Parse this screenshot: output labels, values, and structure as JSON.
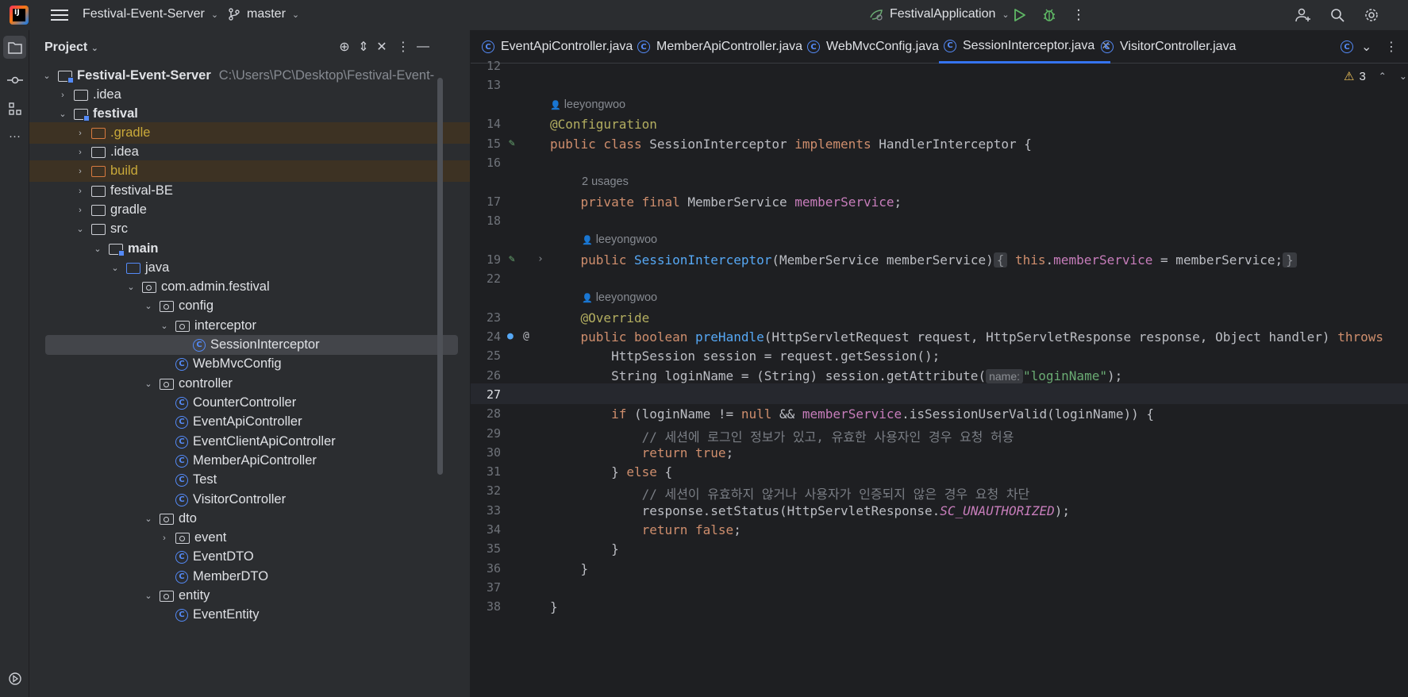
{
  "topbar": {
    "logo_text": "IJ",
    "project_name": "Festival-Event-Server",
    "branch": "master",
    "run_config": "FestivalApplication"
  },
  "project_panel": {
    "title": "Project",
    "root_name": "Festival-Event-Server",
    "root_path": "C:\\Users\\PC\\Desktop\\Festival-Event-",
    "items": [
      {
        "label": ".idea"
      },
      {
        "label": "festival"
      },
      {
        "label": ".gradle"
      },
      {
        "label": ".idea"
      },
      {
        "label": "build"
      },
      {
        "label": "festival-BE"
      },
      {
        "label": "gradle"
      },
      {
        "label": "src"
      },
      {
        "label": "main"
      },
      {
        "label": "java"
      },
      {
        "label": "com.admin.festival"
      },
      {
        "label": "config"
      },
      {
        "label": "interceptor"
      },
      {
        "label": "SessionInterceptor"
      },
      {
        "label": "WebMvcConfig"
      },
      {
        "label": "controller"
      },
      {
        "label": "CounterController"
      },
      {
        "label": "EventApiController"
      },
      {
        "label": "EventClientApiController"
      },
      {
        "label": "MemberApiController"
      },
      {
        "label": "Test"
      },
      {
        "label": "VisitorController"
      },
      {
        "label": "dto"
      },
      {
        "label": "event"
      },
      {
        "label": "EventDTO"
      },
      {
        "label": "MemberDTO"
      },
      {
        "label": "entity"
      },
      {
        "label": "EventEntity"
      }
    ]
  },
  "tabs": [
    {
      "label": "EventApiController.java"
    },
    {
      "label": "MemberApiController.java"
    },
    {
      "label": "WebMvcConfig.java"
    },
    {
      "label": "SessionInterceptor.java"
    },
    {
      "label": "VisitorController.java"
    }
  ],
  "editor": {
    "warning_count": "3",
    "author": "leeyongwoo",
    "usages": "2 usages",
    "param_hint": "name:",
    "line_numbers": [
      "12",
      "13",
      "14",
      "15",
      "16",
      "17",
      "18",
      "19",
      "22",
      "23",
      "24",
      "25",
      "26",
      "27",
      "28",
      "29",
      "30",
      "31",
      "32",
      "33",
      "34",
      "35",
      "36",
      "37",
      "38"
    ],
    "comment_1": "// 세션에 로그인 정보가 있고, 유효한 사용자인 경우 요청 허용",
    "comment_2": "// 세션이 유효하지 않거나 사용자가 인증되지 않은 경우 요청 차단"
  }
}
